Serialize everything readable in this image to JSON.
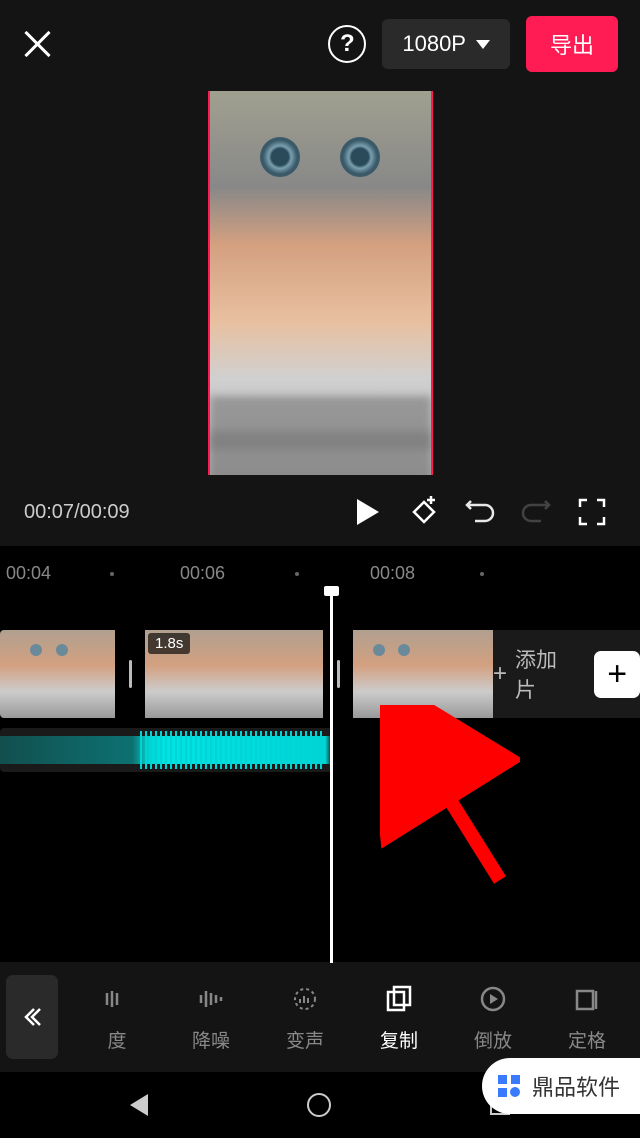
{
  "header": {
    "resolution": "1080P",
    "export": "导出"
  },
  "playback": {
    "current": "00:07",
    "total": "00:09"
  },
  "ruler": {
    "t1": "00:04",
    "t2": "00:06",
    "t3": "00:08"
  },
  "timeline": {
    "clip2_duration": "1.8s",
    "add_segment": "添加片",
    "plus": "+"
  },
  "toolbar": {
    "items": [
      {
        "label": "度",
        "icon": "speed"
      },
      {
        "label": "降噪",
        "icon": "denoise"
      },
      {
        "label": "变声",
        "icon": "voice"
      },
      {
        "label": "复制",
        "icon": "copy",
        "active": true
      },
      {
        "label": "倒放",
        "icon": "reverse"
      },
      {
        "label": "定格",
        "icon": "freeze"
      }
    ]
  },
  "watermark": "鼎品软件"
}
